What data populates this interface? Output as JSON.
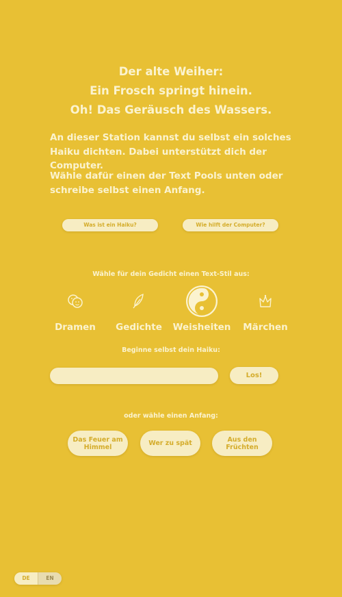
{
  "poem": {
    "line1": "Der alte Weiher:",
    "line2": "Ein Frosch springt hinein.",
    "line3": "Oh! Das Geräusch des Wassers."
  },
  "intro": {
    "p1": "An dieser Station kannst du selbst ein solches Haiku dichten. Dabei unterstützt dich der Computer.",
    "p2": "Wähle dafür einen der Text Pools unten oder schreibe selbst einen Anfang."
  },
  "info_buttons": {
    "what_is_haiku": "Was ist ein Haiku?",
    "how_computer_helps": "Wie hilft der Computer?"
  },
  "style_section": {
    "label": "Wähle für dein Gedicht einen Text-Stil aus:",
    "items": [
      {
        "label": "Dramen",
        "icon": "masks-icon",
        "selected": false
      },
      {
        "label": "Gedichte",
        "icon": "quill-icon",
        "selected": false
      },
      {
        "label": "Weisheiten",
        "icon": "yin-yang-icon",
        "selected": true
      },
      {
        "label": "Märchen",
        "icon": "crown-icon",
        "selected": false
      }
    ]
  },
  "own_start": {
    "label": "Beginne selbst dein Haiku:",
    "input_value": "",
    "input_placeholder": "",
    "go_label": "Los!"
  },
  "choose_start": {
    "label": "oder wähle einen Anfang:",
    "options": [
      "Das Feuer am Himmel",
      "Wer zu spät",
      "Aus den Früchten"
    ]
  },
  "language": {
    "de": "DE",
    "en": "EN",
    "active": "DE"
  },
  "colors": {
    "background": "#e8c034",
    "pill": "#f7edc3",
    "pill_text": "#d4ac2a",
    "text": "#fbf3cf"
  }
}
